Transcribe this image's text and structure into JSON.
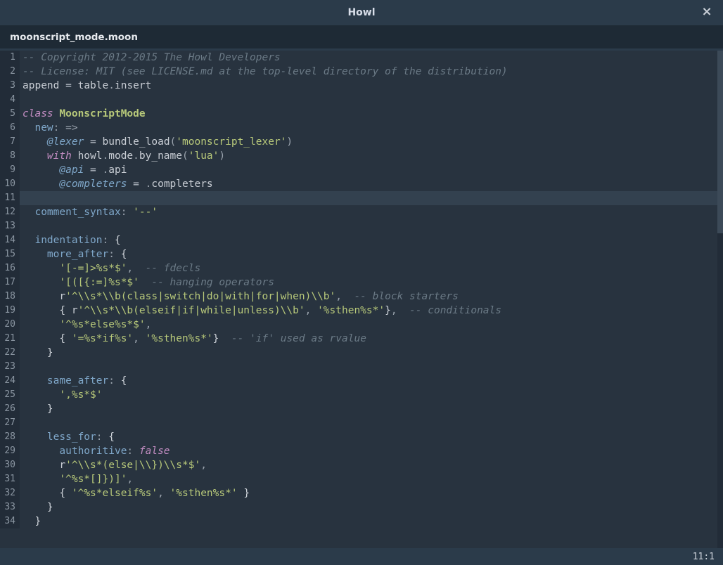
{
  "window": {
    "title": "Howl"
  },
  "tab": {
    "filename": "moonscript_mode.moon"
  },
  "status": {
    "pos": "11:1"
  },
  "gutter": [
    "1",
    "2",
    "3",
    "4",
    "5",
    "6",
    "7",
    "8",
    "9",
    "10",
    "11",
    "12",
    "13",
    "14",
    "15",
    "16",
    "17",
    "18",
    "19",
    "20",
    "21",
    "22",
    "23",
    "24",
    "25",
    "26",
    "27",
    "28",
    "29",
    "30",
    "31",
    "32",
    "33",
    "34"
  ],
  "code": {
    "l1": {
      "cm": "-- Copyright 2012-2015 The Howl Developers"
    },
    "l2": {
      "cm": "-- License: MIT (see LICENSE.md at the top-level directory of the distribution)"
    },
    "l3": {
      "a": "append",
      "b": "table",
      "c": "insert"
    },
    "l5": {
      "kw": "class",
      "name": "MoonscriptMode"
    },
    "l6": {
      "field": "new"
    },
    "l7": {
      "attr": "@lexer",
      "fn": "bundle_load",
      "arg": "'moonscript_lexer'"
    },
    "l8": {
      "kw": "with",
      "a": "howl",
      "b": "mode",
      "c": "by_name",
      "arg": "'lua'"
    },
    "l9": {
      "attr": "@api",
      "rhs": "api"
    },
    "l10": {
      "attr": "@completers",
      "rhs": "completers"
    },
    "l12": {
      "field": "comment_syntax",
      "val": "'--'"
    },
    "l14": {
      "field": "indentation"
    },
    "l15": {
      "field": "more_after"
    },
    "l16": {
      "s": "'[-=]>%s*$'",
      "cm": "-- fdecls"
    },
    "l17": {
      "s": "'[([{:=]%s*$'",
      "cm": "-- hanging operators"
    },
    "l18": {
      "r": "r",
      "s": "'^\\\\s*\\\\b(class|switch|do|with|for|when)\\\\b'",
      "cm": "-- block starters"
    },
    "l19": {
      "r": "r",
      "s1": "'^\\\\s*\\\\b(elseif|if|while|unless)\\\\b'",
      "s2": "'%sthen%s*'",
      "cm": "-- conditionals"
    },
    "l20": {
      "s": "'^%s*else%s*$'"
    },
    "l21": {
      "s1": "'=%s*if%s'",
      "s2": "'%sthen%s*'",
      "cm": "-- 'if' used as rvalue"
    },
    "l24": {
      "field": "same_after"
    },
    "l25": {
      "s": "',%s*$'"
    },
    "l28": {
      "field": "less_for"
    },
    "l29": {
      "field": "authoritive",
      "val": "false"
    },
    "l30": {
      "r": "r",
      "s": "'^\\\\s*(else|\\\\})\\\\s*$'"
    },
    "l31": {
      "s": "'^%s*[]})]'"
    },
    "l32": {
      "s1": "'^%s*elseif%s'",
      "s2": "'%sthen%s*'"
    }
  }
}
